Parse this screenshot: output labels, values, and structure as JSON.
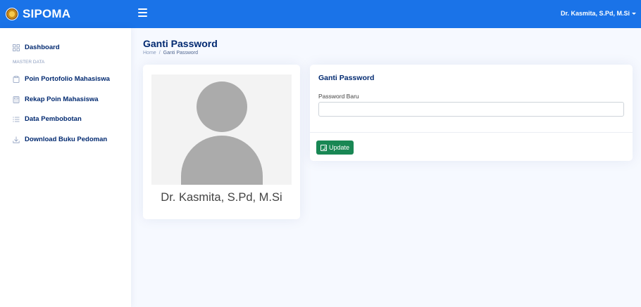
{
  "header": {
    "brand": "SIPOMA",
    "user_name": "Dr. Kasmita, S.Pd, M.Si",
    "background": "#1a73e8"
  },
  "sidebar": {
    "items": [
      {
        "label": "Dashboard",
        "icon": "grid-icon"
      },
      {
        "label": "Poin Portofolio Mahasiswa",
        "icon": "clipboard-icon"
      },
      {
        "label": "Rekap Poin Mahasiswa",
        "icon": "calculator-icon"
      },
      {
        "label": "Data Pembobotan",
        "icon": "list-icon"
      },
      {
        "label": "Download Buku Pedoman",
        "icon": "download-icon"
      }
    ],
    "heading": "MASTER DATA"
  },
  "page": {
    "title": "Ganti Password",
    "breadcrumb": {
      "home": "Home",
      "separator": "/",
      "current": "Ganti Password"
    }
  },
  "profile": {
    "name": "Dr. Kasmita, S.Pd, M.Si"
  },
  "form": {
    "title": "Ganti Password",
    "password_label": "Password Baru",
    "password_value": "",
    "update_label": "Update",
    "button_color": "#198754"
  }
}
